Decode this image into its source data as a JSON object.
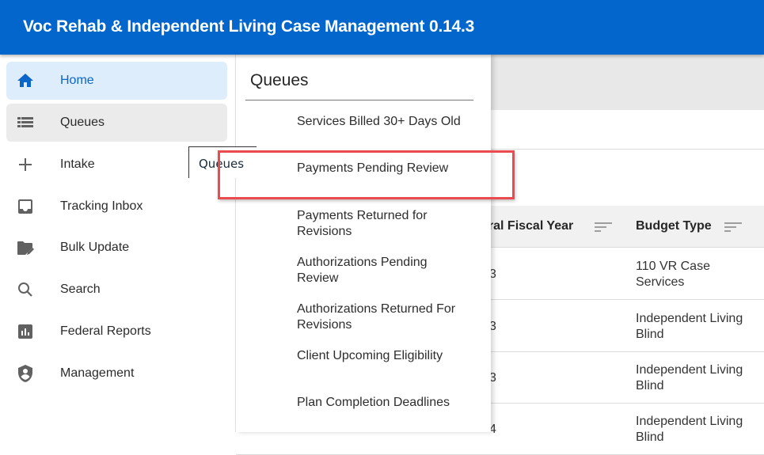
{
  "header": {
    "title": "Voc Rehab & Independent Living Case Management 0.14.3",
    "color": "#0366cd"
  },
  "sidebar": {
    "items": [
      {
        "label": "Home",
        "icon": "home-icon",
        "state": "active"
      },
      {
        "label": "Queues",
        "icon": "list-icon",
        "state": "hover"
      },
      {
        "label": "Intake",
        "icon": "plus-icon"
      },
      {
        "label": "Tracking Inbox",
        "icon": "inbox-icon"
      },
      {
        "label": "Bulk Update",
        "icon": "folder-edit-icon"
      },
      {
        "label": "Search",
        "icon": "search-icon"
      },
      {
        "label": "Federal Reports",
        "icon": "bar-chart-icon"
      },
      {
        "label": "Management",
        "icon": "shield-person-icon"
      }
    ]
  },
  "tooltip": {
    "text": "Queues"
  },
  "queues_menu": {
    "title": "Queues",
    "items": [
      "Services Billed 30+ Days Old",
      "Payments Pending Review",
      "Payments Returned for Revisions",
      "Authorizations Pending Review",
      "Authorizations Returned For Revisions",
      "Client Upcoming Eligibility",
      "Plan Completion Deadlines"
    ],
    "highlighted_index": 1
  },
  "table": {
    "headers": {
      "fiscal_year": "Federal Fiscal Year",
      "fiscal_year_visible": "eral Fiscal Year",
      "budget_type": "Budget Type"
    },
    "rows": [
      {
        "fiscal_year": "3",
        "budget_type": "110 VR Case Services"
      },
      {
        "fiscal_year": "3",
        "budget_type": "Independent Living Blind"
      },
      {
        "fiscal_year": "3",
        "budget_type": "Independent Living Blind"
      },
      {
        "fiscal_year": "4",
        "budget_type": "Independent Living Blind"
      }
    ]
  }
}
